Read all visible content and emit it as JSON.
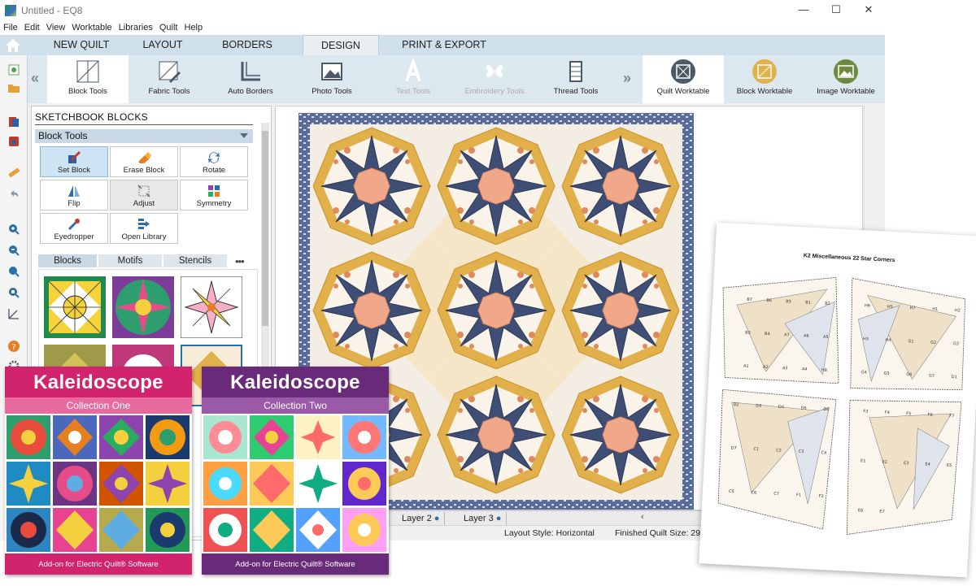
{
  "window": {
    "title": "Untitled - EQ8",
    "minimize": "—",
    "maximize": "☐",
    "close": "✕"
  },
  "menu": [
    "File",
    "Edit",
    "View",
    "Worktable",
    "Libraries",
    "Quilt",
    "Help"
  ],
  "tabs": [
    "NEW QUILT",
    "LAYOUT",
    "BORDERS",
    "DESIGN",
    "PRINT & EXPORT"
  ],
  "active_tab": "DESIGN",
  "ribbon": {
    "tools": [
      "Block Tools",
      "Fabric Tools",
      "Auto Borders",
      "Photo Tools",
      "Text Tools",
      "Embroidery Tools",
      "Thread Tools"
    ],
    "worktables": [
      "Quilt Worktable",
      "Block Worktable",
      "Image Worktable"
    ],
    "nav_left": "«",
    "nav_right": "»"
  },
  "panel": {
    "title": "SKETCHBOOK BLOCKS",
    "section": "Block Tools",
    "buttons": [
      "Set Block",
      "Erase Block",
      "Rotate",
      "Flip",
      "Adjust",
      "Symmetry",
      "Eyedropper",
      "Open Library"
    ],
    "subtabs": [
      "Blocks",
      "Motifs",
      "Stencils"
    ],
    "more": "•••"
  },
  "layers": [
    "Layer 2",
    "Layer 3"
  ],
  "status": {
    "layout_style": "Layout Style: Horizontal",
    "finished_size": "Finished Quilt Size: 29"
  },
  "box_one": {
    "title": "Kaleidoscope",
    "subtitle": "Collection One",
    "footer": "Add-on for Electric Quilt® Software"
  },
  "box_two": {
    "title": "Kaleidoscope",
    "subtitle": "Collection Two",
    "footer": "Add-on for Electric Quilt® Software"
  },
  "sheet": {
    "title": "K2 Miscellaneous 22 Star Corners",
    "labels": [
      "B7",
      "B6",
      "B5",
      "B1",
      "B2",
      "B3",
      "B4",
      "A7",
      "A6",
      "A5",
      "A1",
      "A2",
      "A3",
      "A4",
      "H8",
      "H6",
      "H5",
      "H7",
      "H1",
      "H2",
      "H3",
      "H4",
      "G1",
      "G2",
      "G3",
      "G4",
      "G5",
      "G6",
      "G7",
      "D1",
      "D2",
      "D3",
      "D4",
      "D5",
      "D6",
      "D7",
      "C1",
      "C2",
      "C3",
      "C4",
      "C5",
      "C6",
      "C7",
      "F1",
      "F2",
      "F3",
      "F4",
      "F5",
      "F6",
      "F7",
      "E1",
      "E2",
      "E3",
      "E4",
      "E5",
      "E6",
      "E7"
    ]
  },
  "colors": {
    "tabbar": "#cfe0ea",
    "ribbon": "#dbe8ef",
    "box_one_accent": "#d2236d",
    "box_two_accent": "#6a2a7a",
    "quilt_navy": "#3f4e74",
    "quilt_gold": "#e2b04a",
    "quilt_peach": "#f1a88a"
  }
}
